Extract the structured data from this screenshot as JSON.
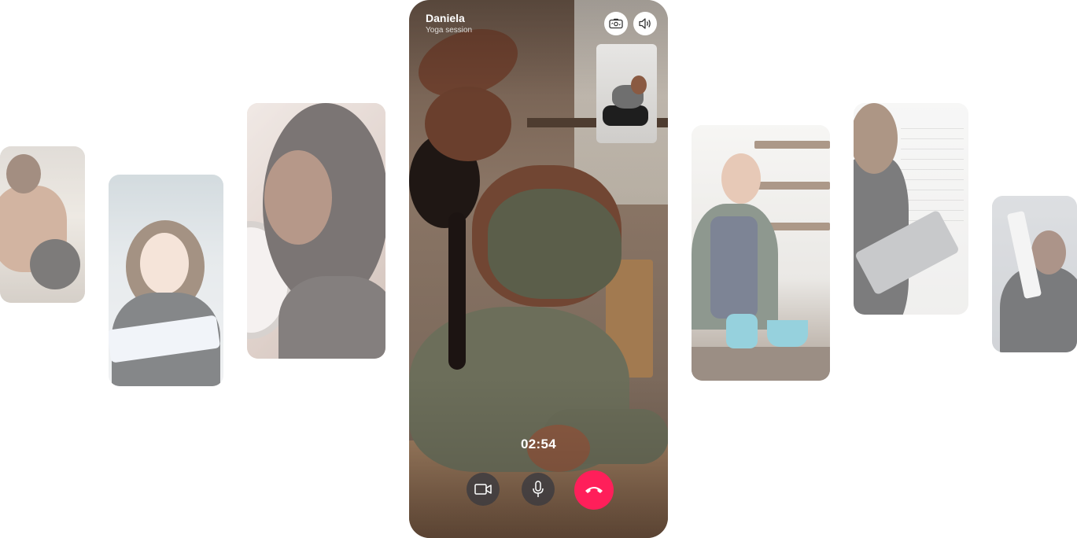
{
  "call": {
    "caller_name": "Daniela",
    "caller_subtitle": "Yoga session",
    "timer": "02:54"
  },
  "controls": {
    "top": [
      {
        "name": "flip-camera-icon"
      },
      {
        "name": "speaker-icon"
      }
    ],
    "bottom": [
      {
        "name": "video-camera-icon"
      },
      {
        "name": "microphone-icon"
      },
      {
        "name": "hang-up-icon",
        "color": "#ff1f5a"
      }
    ]
  },
  "gallery": [
    {
      "name": "preview-gym"
    },
    {
      "name": "preview-reading"
    },
    {
      "name": "preview-earrings"
    },
    {
      "name": "preview-cooking"
    },
    {
      "name": "preview-whiteboard"
    },
    {
      "name": "preview-card-trick"
    }
  ],
  "colors": {
    "end_call": "#ff1f5a",
    "control_bg": "#3c3a40",
    "background": "#ffffff"
  }
}
